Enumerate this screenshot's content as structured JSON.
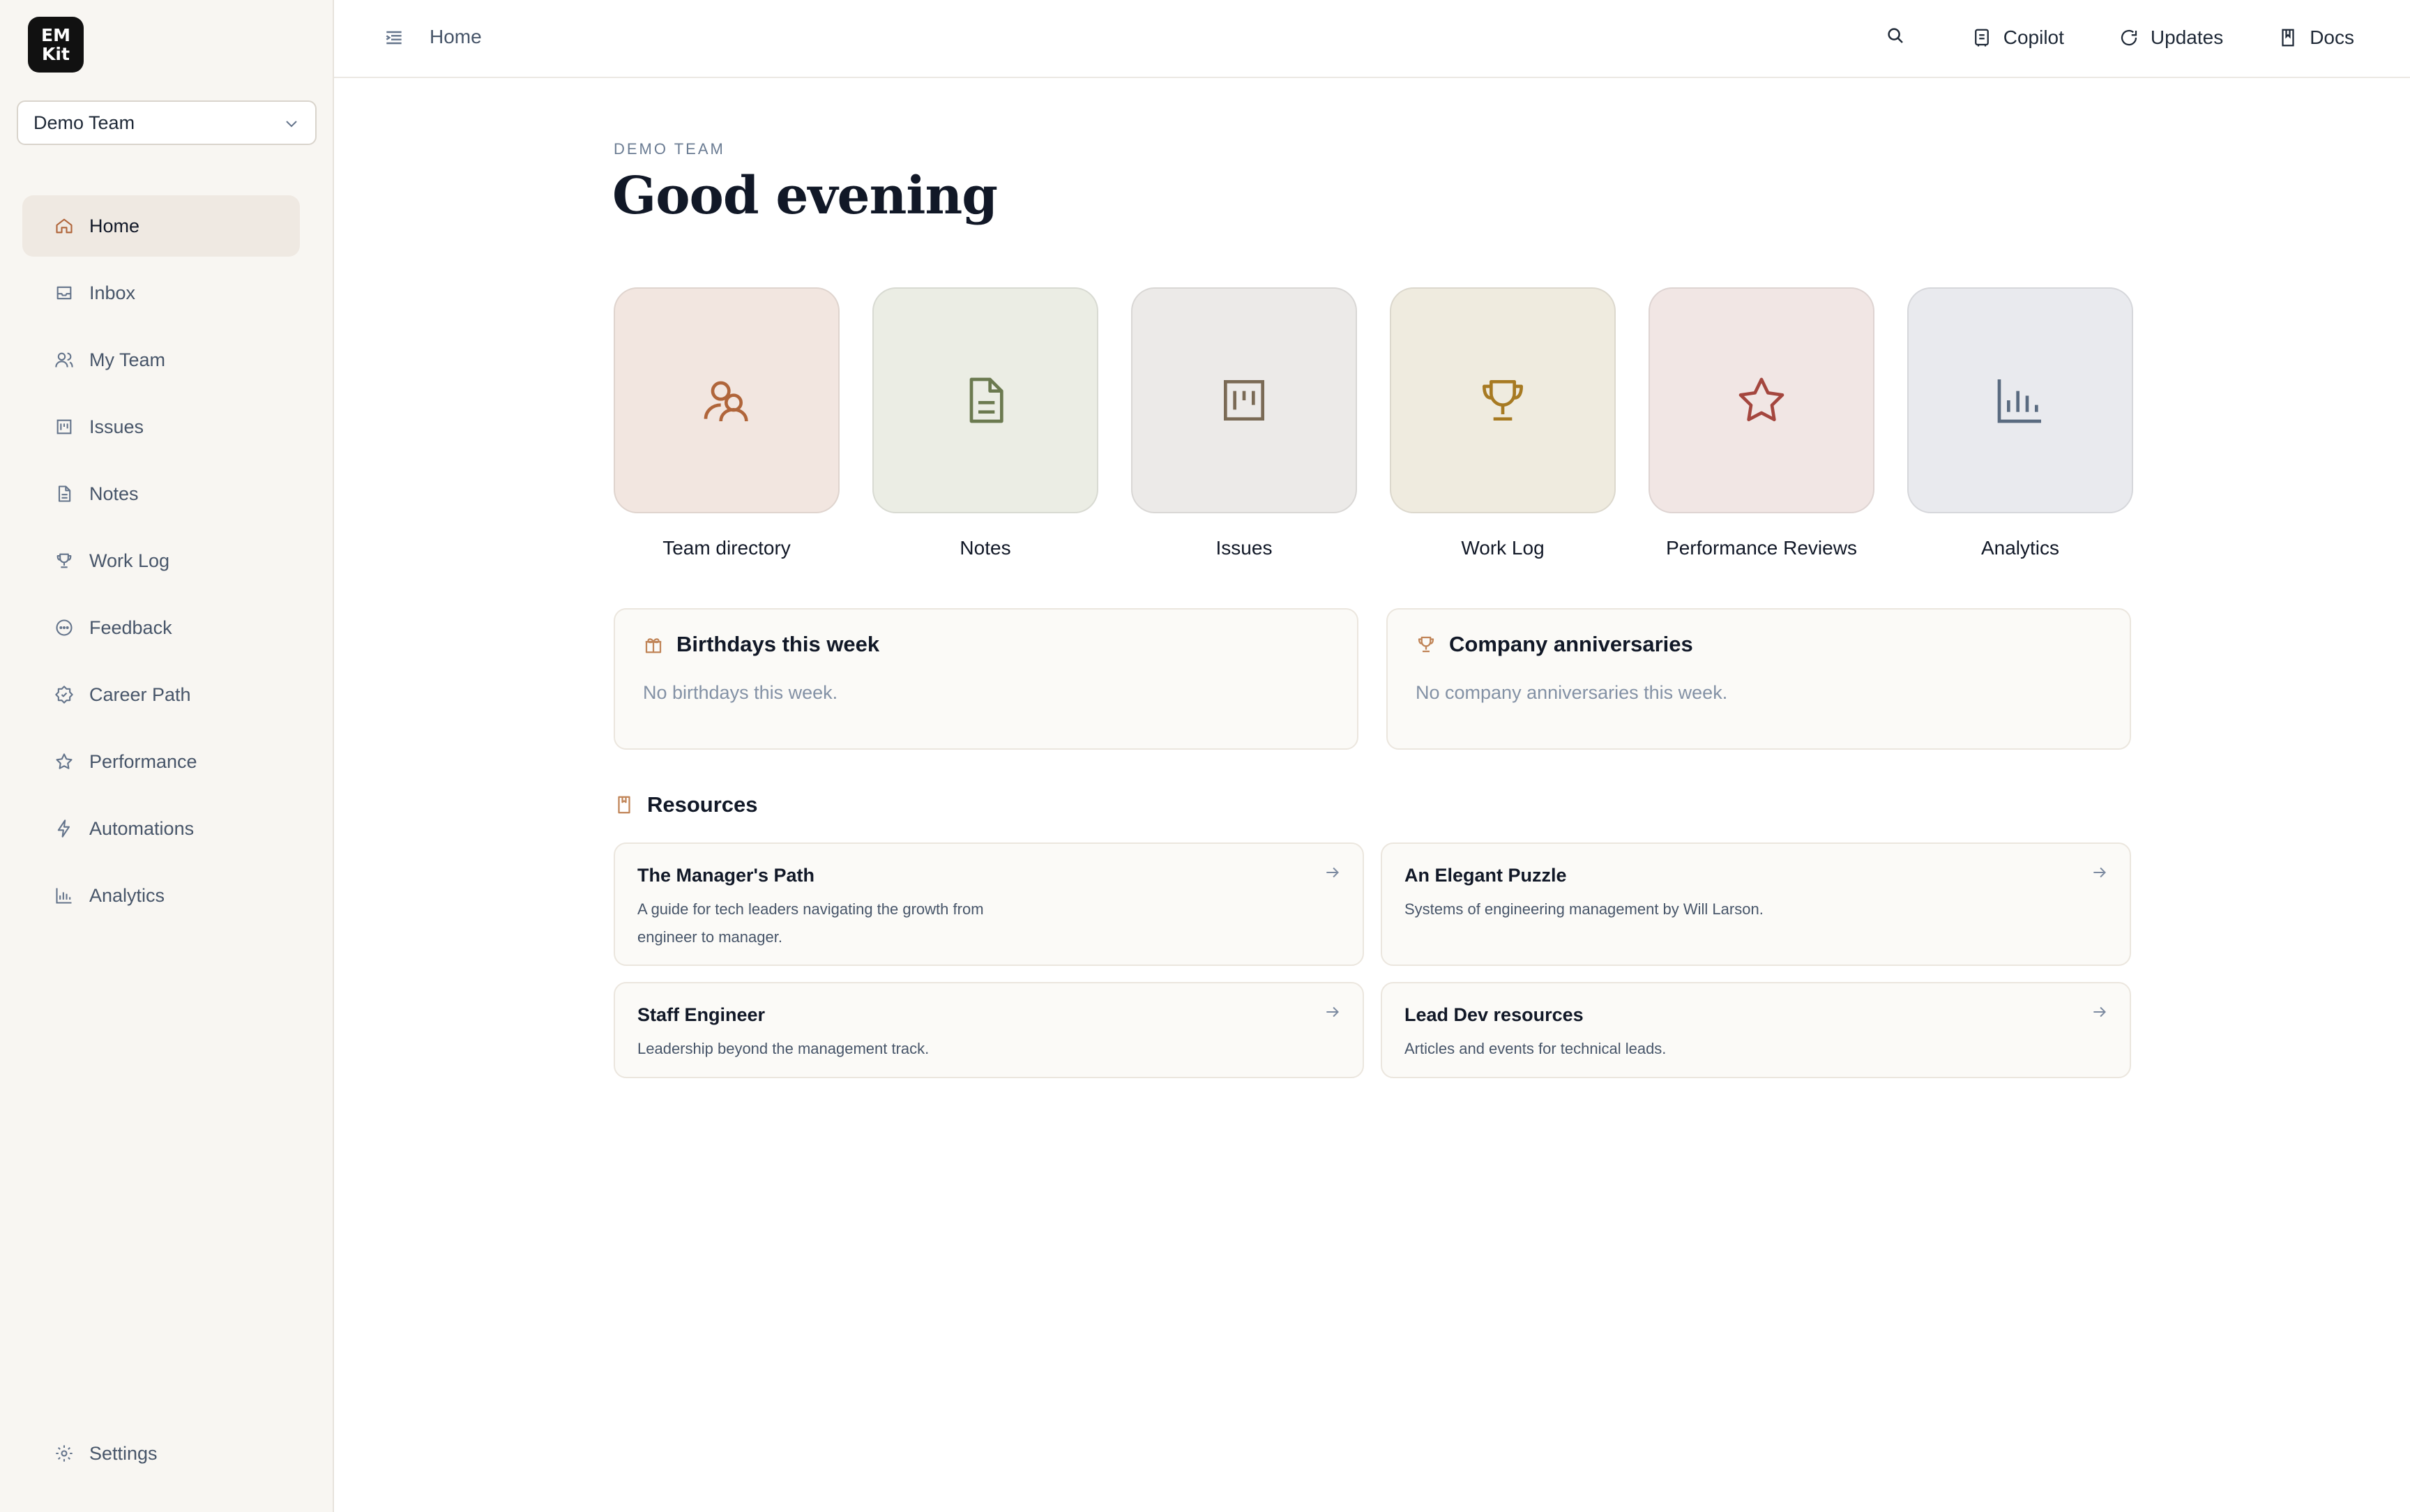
{
  "app": {
    "logo_line1": "EM",
    "logo_line2": "Kit"
  },
  "team_select": {
    "value": "Demo Team"
  },
  "sidebar": {
    "items": [
      {
        "label": "Home",
        "icon": "home-icon",
        "active": true
      },
      {
        "label": "Inbox",
        "icon": "inbox-icon"
      },
      {
        "label": "My Team",
        "icon": "users-icon"
      },
      {
        "label": "Issues",
        "icon": "kanban-icon"
      },
      {
        "label": "Notes",
        "icon": "file-icon"
      },
      {
        "label": "Work Log",
        "icon": "trophy-icon"
      },
      {
        "label": "Feedback",
        "icon": "chat-icon"
      },
      {
        "label": "Career Path",
        "icon": "badge-icon"
      },
      {
        "label": "Performance",
        "icon": "star-icon"
      },
      {
        "label": "Automations",
        "icon": "bolt-icon"
      },
      {
        "label": "Analytics",
        "icon": "chart-icon"
      }
    ],
    "settings_label": "Settings"
  },
  "topbar": {
    "breadcrumb": "Home",
    "copilot": "Copilot",
    "updates": "Updates",
    "docs": "Docs"
  },
  "main": {
    "eyebrow": "DEMO TEAM",
    "greeting": "Good evening",
    "tiles": [
      {
        "label": "Team directory",
        "icon": "users-icon",
        "bg": "#f2e6e0",
        "fg": "#b0653a"
      },
      {
        "label": "Notes",
        "icon": "file-icon",
        "bg": "#ebede4",
        "fg": "#6b7a4f"
      },
      {
        "label": "Issues",
        "icon": "kanban-icon",
        "bg": "#eceae8",
        "fg": "#7a6a55"
      },
      {
        "label": "Work Log",
        "icon": "trophy-icon",
        "bg": "#efebdf",
        "fg": "#a77a22"
      },
      {
        "label": "Performance Reviews",
        "icon": "star-icon",
        "bg": "#f1e6e4",
        "fg": "#a4463e"
      },
      {
        "label": "Analytics",
        "icon": "chart-icon",
        "bg": "#e9eaee",
        "fg": "#5a6b80"
      }
    ],
    "birthdays": {
      "title": "Birthdays this week",
      "empty": "No birthdays this week."
    },
    "anniversaries": {
      "title": "Company anniversaries",
      "empty": "No company anniversaries this week."
    },
    "resources": {
      "title": "Resources",
      "items": [
        {
          "title": "The Manager's Path",
          "desc": "A guide for tech leaders navigating the growth from engineer to manager."
        },
        {
          "title": "An Elegant Puzzle",
          "desc": "Systems of engineering management by Will Larson."
        },
        {
          "title": "Staff Engineer",
          "desc": "Leadership beyond the management track."
        },
        {
          "title": "Lead Dev resources",
          "desc": "Articles and events for technical leads."
        }
      ]
    }
  },
  "colors": {
    "accent": "#b0653a",
    "sidebar_bg": "#f8f6f2",
    "active_item_bg": "#efe9e2"
  }
}
